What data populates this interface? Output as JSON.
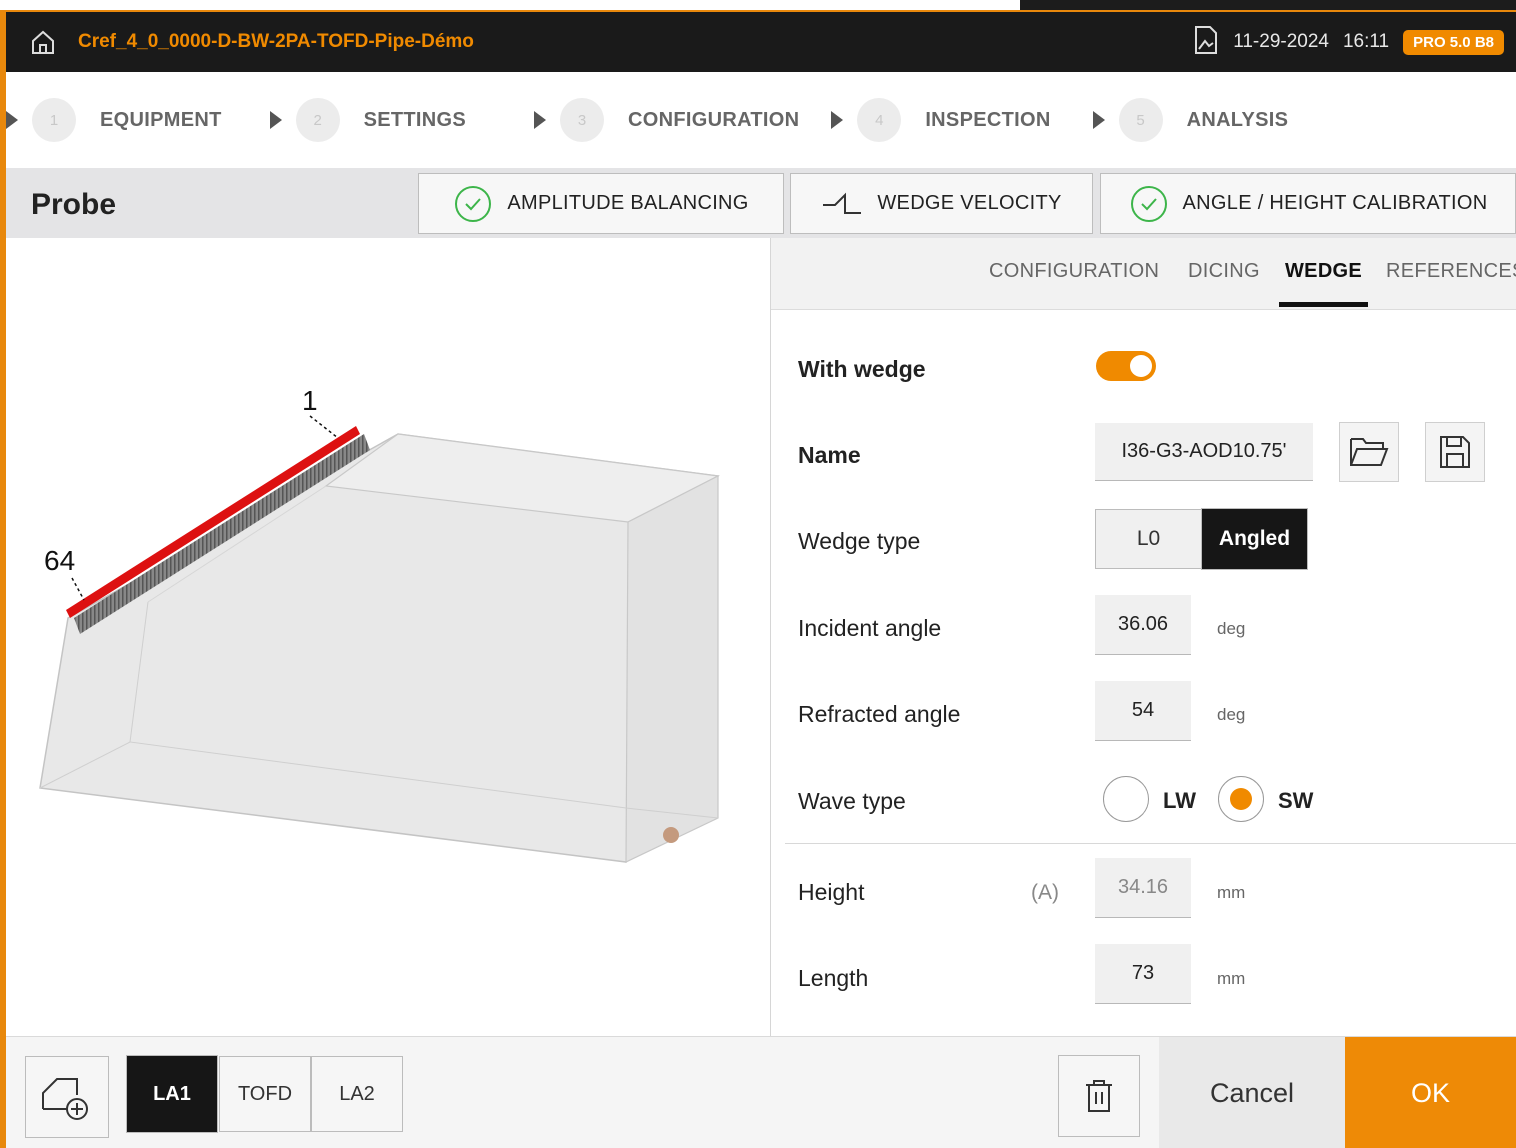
{
  "header": {
    "file_name": "Cref_4_0_0000-D-BW-2PA-TOFD-Pipe-Démo",
    "date": "11-29-2024",
    "time": "16:11",
    "version_badge": "PRO 5.0 B8"
  },
  "steps": [
    {
      "num": "1",
      "label": "EQUIPMENT"
    },
    {
      "num": "2",
      "label": "SETTINGS"
    },
    {
      "num": "3",
      "label": "CONFIGURATION"
    },
    {
      "num": "4",
      "label": "INSPECTION"
    },
    {
      "num": "5",
      "label": "ANALYSIS"
    }
  ],
  "toolbar": {
    "title": "Probe",
    "amplitude_balancing": "AMPLITUDE BALANCING",
    "wedge_velocity": "WEDGE VELOCITY",
    "angle_height_calibration": "ANGLE / HEIGHT CALIBRATION"
  },
  "viewport": {
    "first_element_label": "1",
    "last_element_label": "64"
  },
  "subtabs": [
    {
      "label": "CONFIGURATION",
      "active": false
    },
    {
      "label": "DICING",
      "active": false
    },
    {
      "label": "WEDGE",
      "active": true
    },
    {
      "label": "REFERENCES",
      "active": false
    }
  ],
  "wedge": {
    "with_wedge_label": "With wedge",
    "with_wedge_on": true,
    "name_label": "Name",
    "name_value": "I36-G3-AOD10.75'",
    "wedge_type_label": "Wedge type",
    "wedge_type_options": [
      "L0",
      "Angled"
    ],
    "wedge_type_selected": "Angled",
    "incident_angle_label": "Incident angle",
    "incident_angle_value": "36.06",
    "incident_angle_unit": "deg",
    "refracted_angle_label": "Refracted angle",
    "refracted_angle_value": "54",
    "refracted_angle_unit": "deg",
    "wave_type_label": "Wave type",
    "wave_type_options": [
      "LW",
      "SW"
    ],
    "wave_type_selected": "SW",
    "height_label": "Height",
    "height_mode": "(A)",
    "height_value": "34.16",
    "height_unit": "mm",
    "length_label": "Length",
    "length_value": "73",
    "length_unit": "mm"
  },
  "bottom": {
    "probe_tabs": [
      "LA1",
      "TOFD",
      "LA2"
    ],
    "active_probe": "LA1",
    "cancel": "Cancel",
    "ok": "OK"
  },
  "colors": {
    "accent": "#f08a00",
    "header_bg": "#1a1a1a",
    "active_segment": "#161616",
    "check_green": "#3db54a",
    "array_red": "#dd1111"
  }
}
